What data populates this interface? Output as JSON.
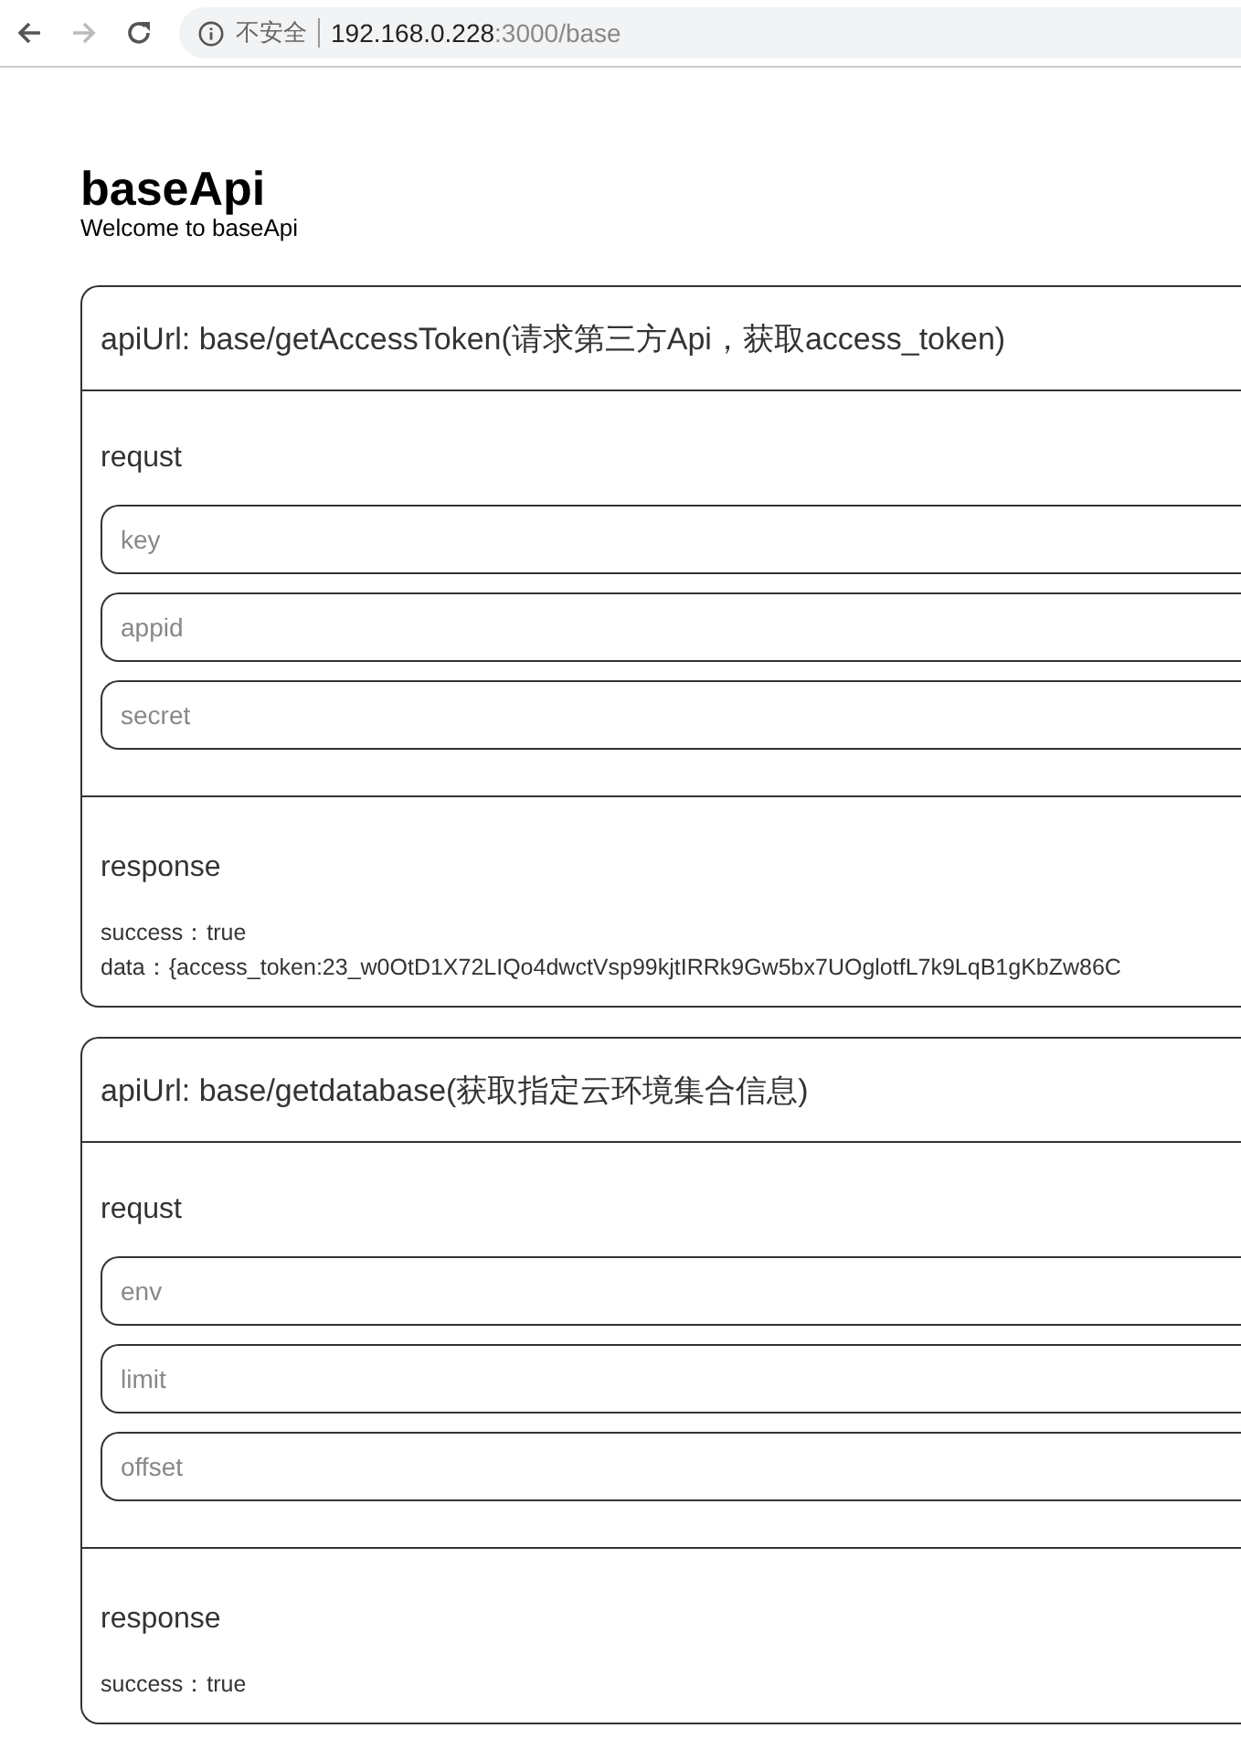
{
  "browser": {
    "security": "不安全",
    "url_host": "192.168.0.228",
    "url_path": ":3000/base"
  },
  "page": {
    "title": "baseApi",
    "subtitle": "Welcome to baseApi"
  },
  "apis": [
    {
      "url": "apiUrl: base/getAccessToken(请求第三方Api，获取access_token)",
      "request_title": "requst",
      "fields": [
        {
          "placeholder": "key"
        },
        {
          "placeholder": "appid"
        },
        {
          "placeholder": "secret"
        }
      ],
      "response_title": "response",
      "response_lines": [
        "success：true",
        "data：{access_token:23_w0OtD1X72LIQo4dwctVsp99kjtIRRk9Gw5bx7UOglotfL7k9LqB1gKbZw86C"
      ]
    },
    {
      "url": "apiUrl: base/getdatabase(获取指定云环境集合信息)",
      "request_title": "requst",
      "fields": [
        {
          "placeholder": "env"
        },
        {
          "placeholder": "limit"
        },
        {
          "placeholder": "offset"
        }
      ],
      "response_title": "response",
      "response_lines": [
        "success：true"
      ]
    }
  ]
}
